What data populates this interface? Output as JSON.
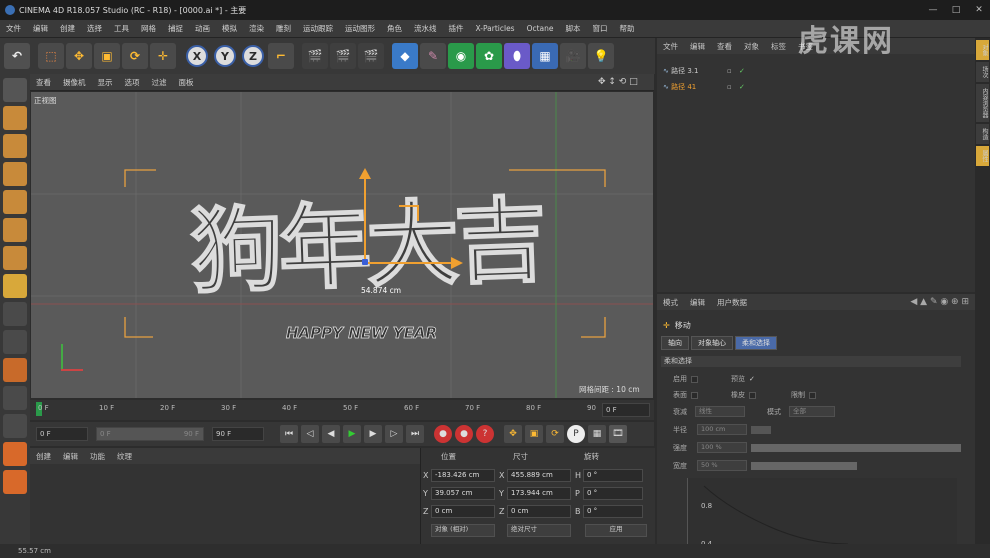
{
  "window": {
    "title": "CINEMA 4D R18.057 Studio (RC - R18) - [0000.ai *] - 主要"
  },
  "menu": [
    "文件",
    "编辑",
    "创建",
    "选择",
    "工具",
    "网格",
    "捕捉",
    "动画",
    "模拟",
    "渲染",
    "雕刻",
    "运动跟踪",
    "运动图形",
    "角色",
    "流水线",
    "插件",
    "X-Particles",
    "Octane",
    "脚本",
    "窗口",
    "帮助"
  ],
  "toolbar": {
    "axis_x": "X",
    "axis_y": "Y",
    "axis_z": "Z"
  },
  "viewport": {
    "menu": [
      "查看",
      "摄像机",
      "显示",
      "选项",
      "过滤",
      "面板"
    ],
    "label": "正视图",
    "measure": "54.874 cm",
    "grid_spacing": "网格间距 : 10 cm",
    "art_text": "狗年大吉",
    "art_sub": "HAPPY NEW YEAR"
  },
  "timeline": {
    "ticks": [
      "0 F",
      "10 F",
      "20 F",
      "30 F",
      "40 F",
      "50 F",
      "60 F",
      "70 F",
      "80 F",
      "90"
    ],
    "end_field": "0 F"
  },
  "playback": {
    "current": "0 F",
    "range_start": "0 F",
    "range_end": "90 F",
    "max": "90 F"
  },
  "materials": {
    "menu": [
      "创建",
      "编辑",
      "功能",
      "纹理"
    ]
  },
  "coords": {
    "headers": [
      "位置",
      "尺寸",
      "旋转"
    ],
    "rows": [
      {
        "axis": "X",
        "pos": "-183.426 cm",
        "size_axis": "X",
        "size": "455.889 cm",
        "rot_axis": "H",
        "rot": "0 °"
      },
      {
        "axis": "Y",
        "pos": "39.057 cm",
        "size_axis": "Y",
        "size": "173.944 cm",
        "rot_axis": "P",
        "rot": "0 °"
      },
      {
        "axis": "Z",
        "pos": "0 cm",
        "size_axis": "Z",
        "size": "0 cm",
        "rot_axis": "B",
        "rot": "0 °"
      }
    ],
    "mode": "对象 (相对)",
    "size_mode": "绝对尺寸",
    "apply": "应用"
  },
  "objects": {
    "menu": [
      "文件",
      "编辑",
      "查看",
      "对象",
      "标签",
      "书签"
    ],
    "items": [
      "路径 3.1",
      "路径 41"
    ]
  },
  "attributes": {
    "menu": [
      "模式",
      "编辑",
      "用户数据"
    ],
    "tool": "移动",
    "tabs": [
      "轴向",
      "对象轴心",
      "柔和选择"
    ],
    "section": "柔和选择",
    "enable": "启用",
    "preview": "预览",
    "surface": "表面",
    "rubber": "橡皮",
    "restrict": "限制",
    "falloff": "衰减",
    "falloff_val": "线性",
    "mode_label": "模式",
    "mode_val": "全部",
    "radius": "半径",
    "radius_val": "100 cm",
    "strength": "强度",
    "strength_val": "100 %",
    "width": "宽度",
    "width_val": "50 %",
    "graph_1": "0.8",
    "graph_2": "0.4"
  },
  "right_tabs": [
    "对象",
    "场次",
    "内容浏览器",
    "构造",
    "属性"
  ],
  "status": "55.57 cm",
  "watermark": "虎课网"
}
